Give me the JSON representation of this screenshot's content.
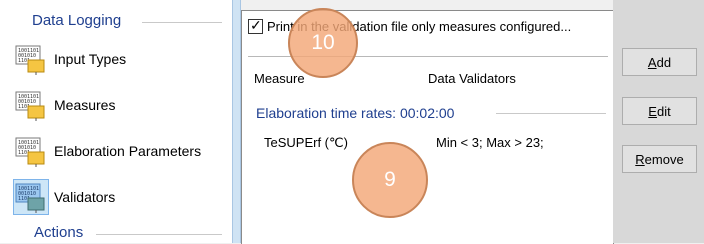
{
  "nav": {
    "data_logging_header": "Data Logging",
    "items": [
      {
        "label": "Input Types",
        "icon": "binary-data-icon"
      },
      {
        "label": "Measures",
        "icon": "binary-data-icon"
      },
      {
        "label": "Elaboration Parameters",
        "icon": "binary-data-icon"
      },
      {
        "label": "Validators",
        "icon": "binary-data-icon",
        "selected": true
      }
    ],
    "actions_header": "Actions"
  },
  "main": {
    "checkbox_label": "Print in the validation file only measures configured...",
    "checkbox_checked": true,
    "columns": [
      "Measure",
      "Data Validators"
    ],
    "group_header": "Elaboration time rates: 00:02:00",
    "rows": [
      {
        "measure": "TeSUPErf (℃)",
        "validators": "Min  < 3; Max  > 23;"
      }
    ]
  },
  "buttons": {
    "add": {
      "mnemonic": "A",
      "rest": "dd"
    },
    "edit": {
      "mnemonic": "E",
      "rest": "dit"
    },
    "remove": {
      "mnemonic": "R",
      "rest": "emove"
    }
  },
  "callouts": {
    "c10": "10",
    "c9": "9"
  },
  "colors": {
    "accent": "#1f3f8f",
    "callout": "#f3a778",
    "splitter": "#cfe3f4"
  }
}
